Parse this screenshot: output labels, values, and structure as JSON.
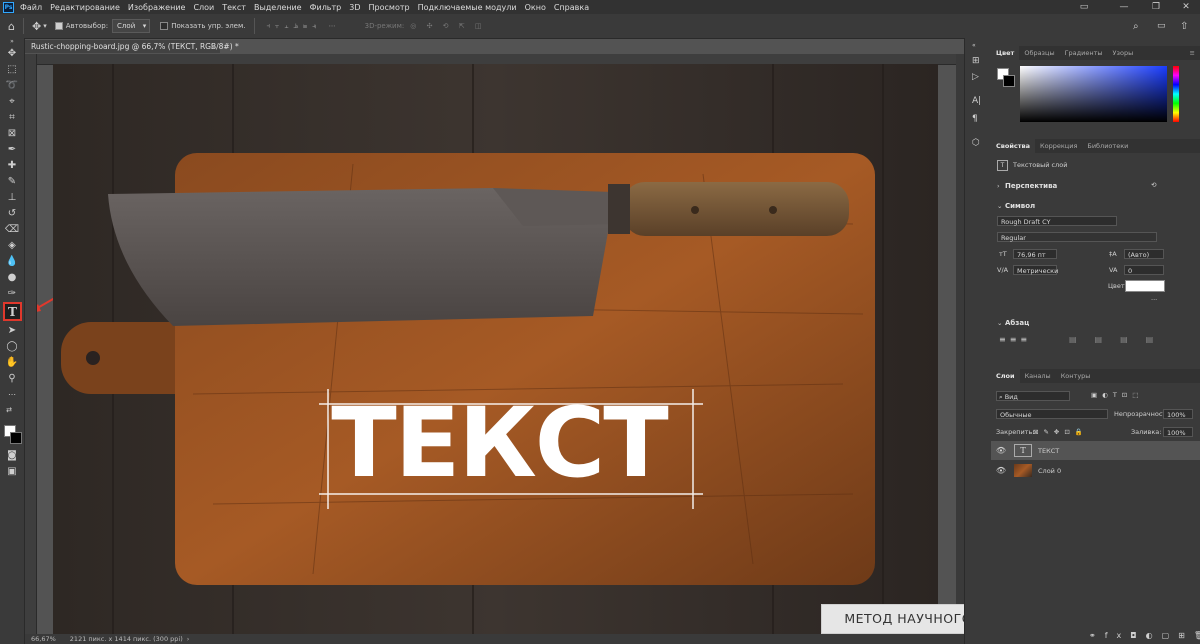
{
  "menubar": {
    "app_logo": "Ps",
    "items": [
      "Файл",
      "Редактирование",
      "Изображение",
      "Слои",
      "Текст",
      "Выделение",
      "Фильтр",
      "3D",
      "Просмотр",
      "Подключаемые модули",
      "Окно",
      "Справка"
    ]
  },
  "optionsbar": {
    "autoselect_label": "Автовыбор:",
    "autoselect_value": "Слой",
    "show_controls_label": "Показать упр. элем.",
    "mode_3d_label": "3D-режим:",
    "more_label": "···"
  },
  "document": {
    "tab_title": "Rustic-chopping-board.jpg @ 66,7% (ТЕКСТ, RGB/8#) *",
    "canvas_text": "ТЕКСТ",
    "zoom": "66,67%",
    "doc_info": "2121 пикс. x 1414 пикс. (300 ppi)"
  },
  "panels": {
    "color_tabs": [
      "Цвет",
      "Образцы",
      "Градиенты",
      "Узоры"
    ],
    "props_tabs": [
      "Свойства",
      "Коррекция",
      "Библиотеки"
    ],
    "layer_kind": "Текстовый слой",
    "perspective_label": "Перспектива",
    "symbol_label": "Символ",
    "font_family": "Rough Draft CY",
    "font_style": "Regular",
    "font_size": "76,96 пт",
    "leading": "(Авто)",
    "kerning": "Метрически",
    "tracking": "0",
    "color_label": "Цвет",
    "paragraph_label": "Абзац",
    "layers_tabs": [
      "Слои",
      "Каналы",
      "Контуры"
    ],
    "filter_kind": "Вид",
    "blend_mode": "Обычные",
    "opacity_label": "Непрозрачность:",
    "opacity_value": "100%",
    "lock_label": "Закрепить:",
    "fill_label": "Заливка:",
    "fill_value": "100%",
    "layers": [
      {
        "name": "ТЕКСТ",
        "type": "text"
      },
      {
        "name": "Слой 0",
        "type": "image"
      }
    ]
  },
  "watermark": "МЕТОД НАУЧНОГО ТЫКА",
  "colors": {
    "accent_red": "#e0382c",
    "foreground": "#ffffff",
    "background": "#000000"
  }
}
